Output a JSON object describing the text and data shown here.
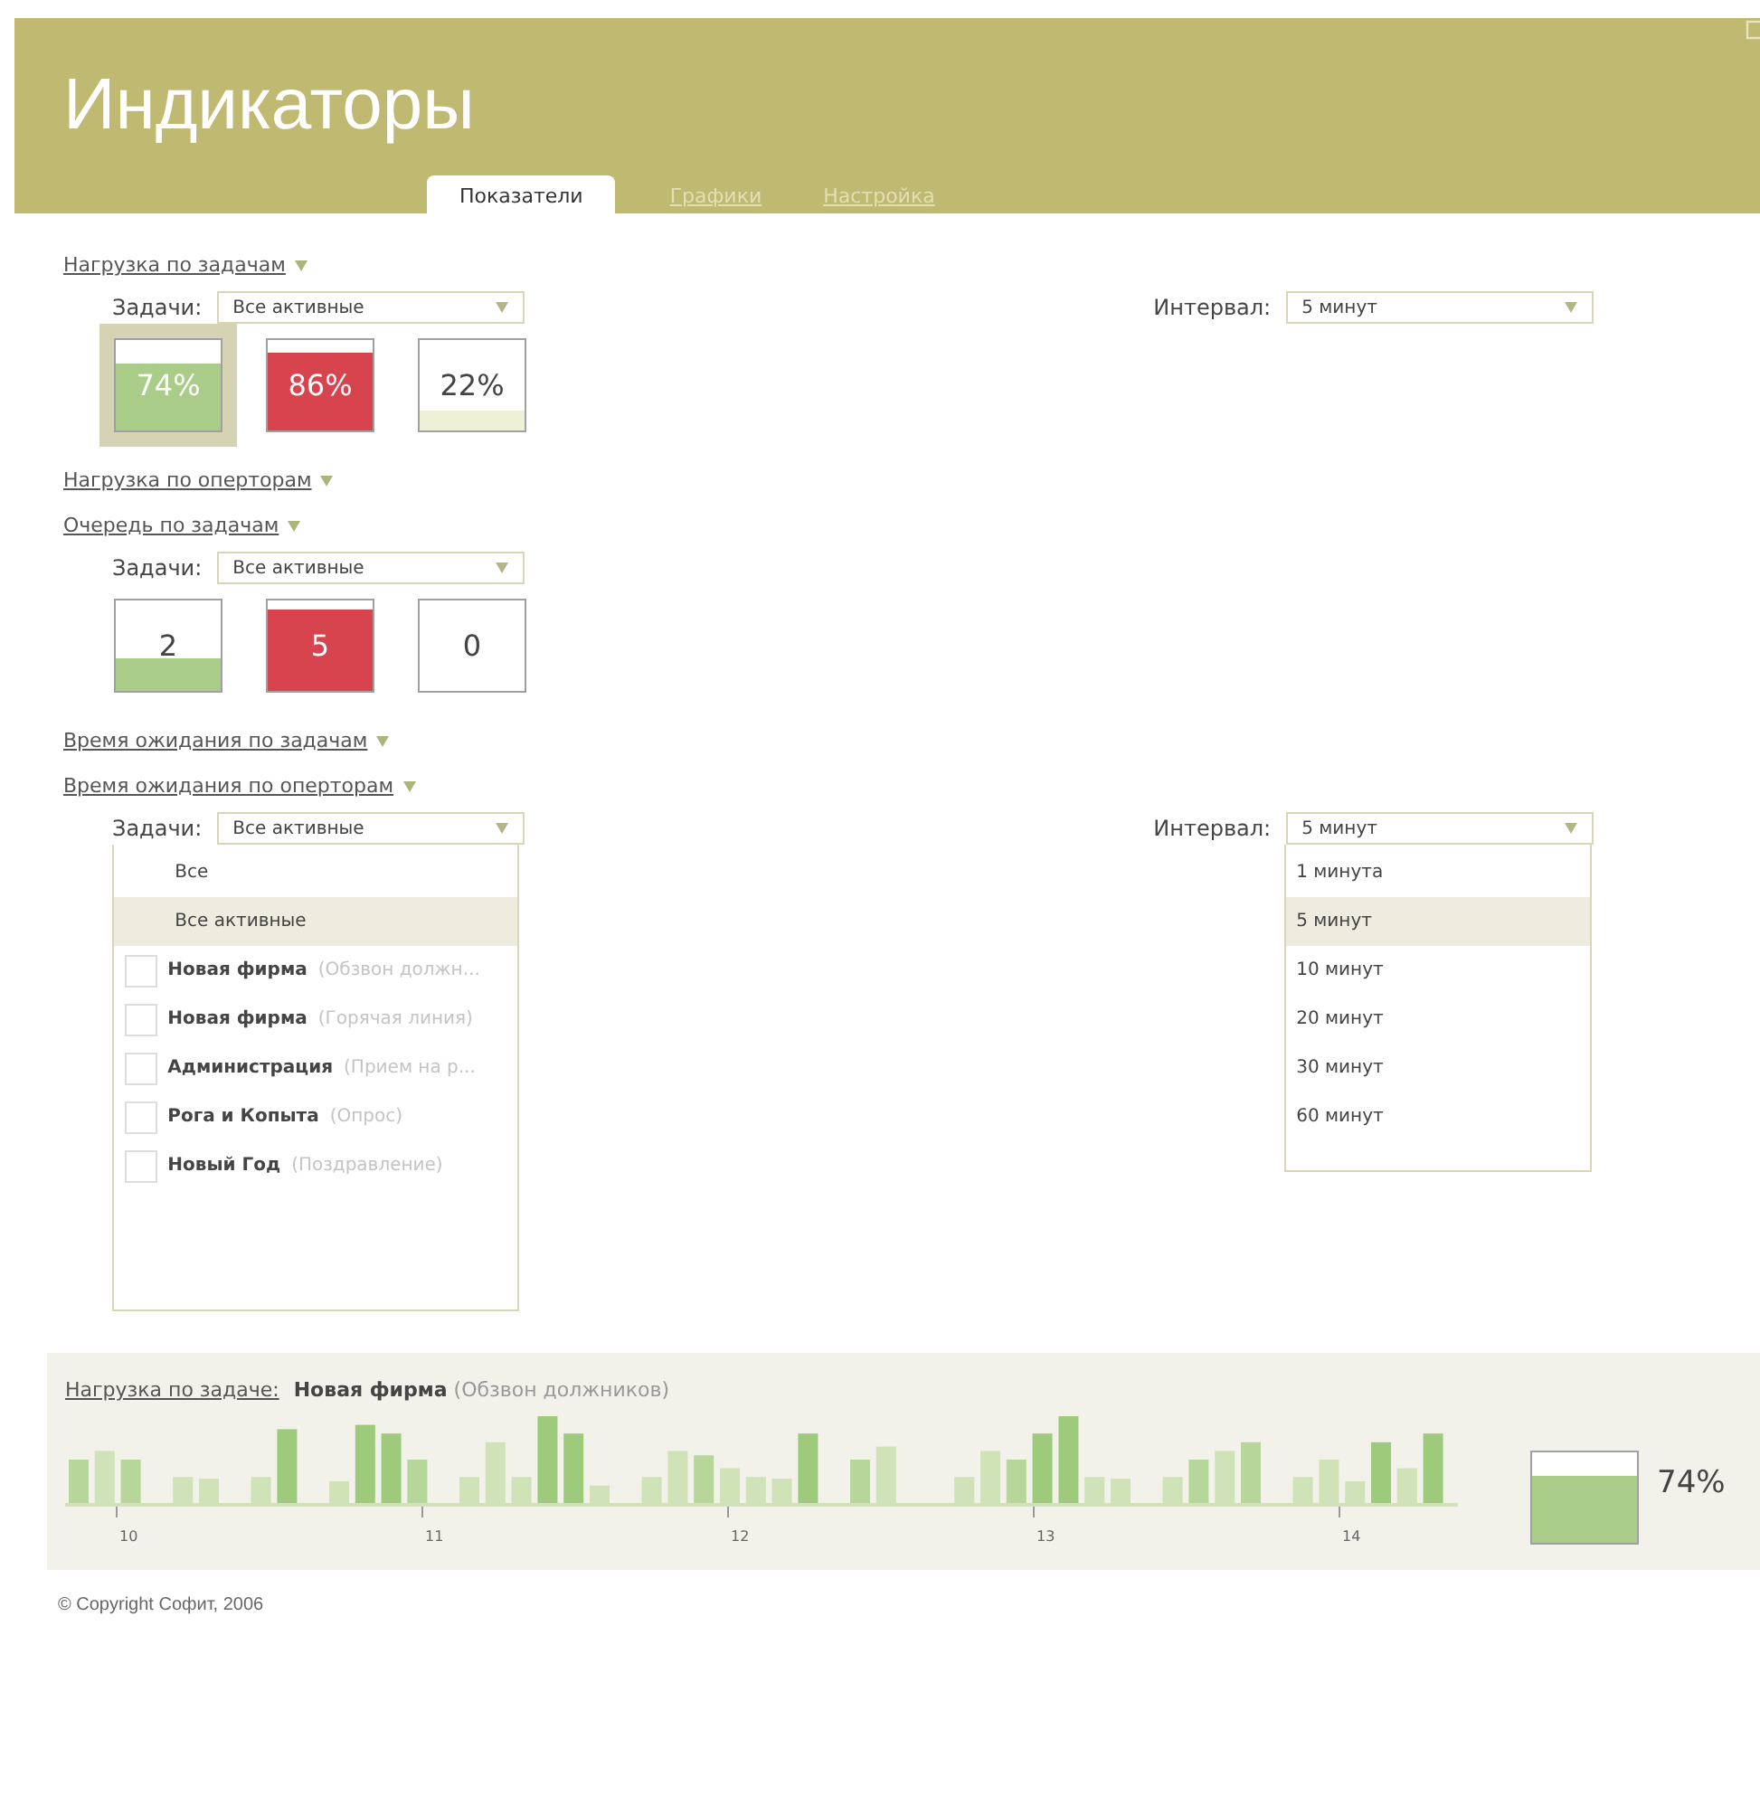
{
  "header": {
    "title": "Индикаторы"
  },
  "tabs": [
    {
      "label": "Показатели",
      "selected": true
    },
    {
      "label": "Графики",
      "selected": false
    },
    {
      "label": "Настройка",
      "selected": false
    }
  ],
  "sections": [
    {
      "title": "Нагрузка по задачам",
      "tasks": {
        "label": "Задачи:",
        "value": "Все активные"
      },
      "interval": {
        "label": "Интервал:",
        "value": "5 минут"
      },
      "meters": [
        {
          "value": "74%",
          "color": "#a9cd89",
          "selected": true
        },
        {
          "value": "86%",
          "color": "#d8444e",
          "selected": false
        },
        {
          "value": "22%",
          "color": "#eff1d6",
          "selected": false
        }
      ]
    },
    {
      "title": "Нагрузка по оперторам"
    },
    {
      "title": "Очередь по задачам",
      "tasks": {
        "label": "Задачи:",
        "value": "Все активные"
      },
      "meters": [
        {
          "value": "2",
          "color": "#a9cd89"
        },
        {
          "value": "5",
          "color": "#d8444e"
        },
        {
          "value": "0"
        }
      ]
    },
    {
      "title": "Время ожидания по задачам"
    },
    {
      "title": "Время ожидания по оперторам",
      "tasks": {
        "label": "Задачи:",
        "value": "Все активные",
        "options": [
          {
            "kind": "plain",
            "name": "Все",
            "selected": false
          },
          {
            "kind": "plain",
            "name": "Все активные",
            "selected": true
          },
          {
            "kind": "check",
            "name": "Новая фирма",
            "note": "(Обзвон должн...",
            "checked": false
          },
          {
            "kind": "check",
            "name": "Новая фирма",
            "note": "(Горячая линия)",
            "checked": false
          },
          {
            "kind": "check",
            "name": "Администрация",
            "note": "(Прием на р...",
            "checked": false
          },
          {
            "kind": "check",
            "name": "Рога и Копыта",
            "note": "(Опрос)",
            "checked": false
          },
          {
            "kind": "check",
            "name": "Новый Год",
            "note": "(Поздравление)",
            "checked": false
          }
        ]
      },
      "interval": {
        "label": "Интервал:",
        "value": "5 минут",
        "options": [
          {
            "kind": "plain",
            "name": "1 минута",
            "selected": false
          },
          {
            "kind": "plain",
            "name": "5 минут",
            "selected": true
          },
          {
            "kind": "plain",
            "name": "10 минут",
            "selected": false
          },
          {
            "kind": "plain",
            "name": "20 минут",
            "selected": false
          },
          {
            "kind": "plain",
            "name": "30 минут",
            "selected": false
          },
          {
            "kind": "plain",
            "name": "60 минут",
            "selected": false
          }
        ]
      }
    }
  ],
  "task_panel": {
    "label": "Нагрузка по задаче:",
    "task": "Новая фирма",
    "note": "(Обзвон должников)",
    "ticks": [
      "10",
      "11",
      "12",
      "13",
      "14"
    ],
    "meter": {
      "value": "74%",
      "color": "#a9cd89"
    }
  },
  "footer": "© Copyright Софит, 2006"
}
